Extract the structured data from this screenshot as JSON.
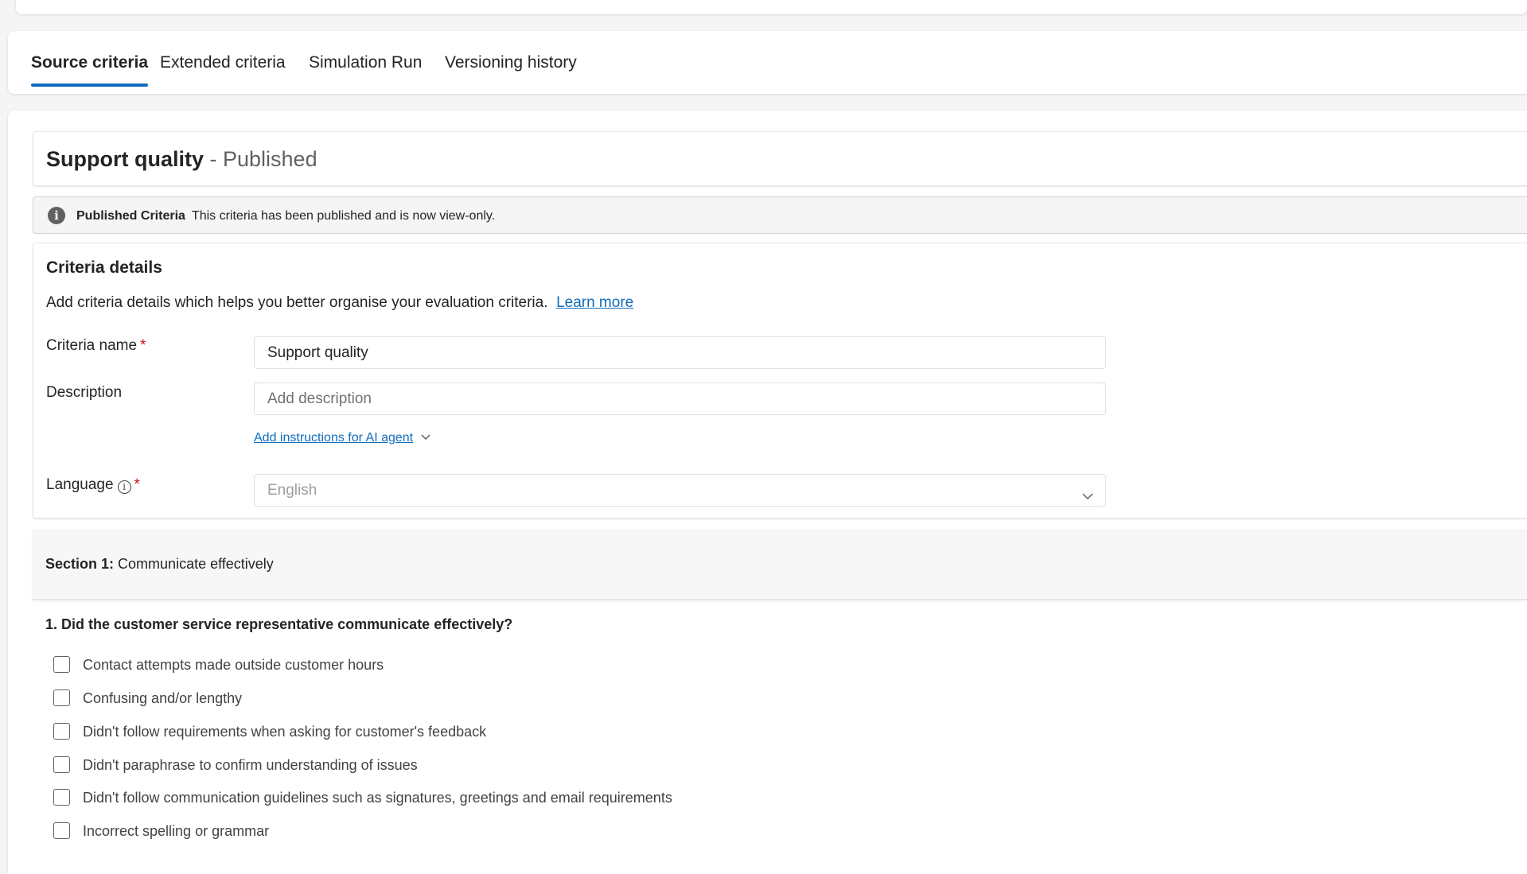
{
  "tabs": [
    {
      "label": "Source criteria",
      "active": true
    },
    {
      "label": "Extended criteria",
      "active": false
    },
    {
      "label": "Simulation Run",
      "active": false
    },
    {
      "label": "Versioning history",
      "active": false
    }
  ],
  "page": {
    "title": "Support quality",
    "separator": " - ",
    "status": "Published"
  },
  "banner": {
    "icon": "info-icon",
    "title": "Published Criteria",
    "message": "This criteria has been published and is now view-only."
  },
  "details": {
    "heading": "Criteria details",
    "description": "Add criteria details which helps you better organise your evaluation criteria.",
    "learn_more": "Learn more",
    "name_label": "Criteria name",
    "name_value": "Support quality",
    "description_label": "Description",
    "description_placeholder": "Add description",
    "ai_instructions_link": "Add instructions for AI agent",
    "language_label": "Language",
    "language_value": "English",
    "required_mark": "*"
  },
  "section": {
    "prefix": "Section 1:",
    "title": "Communicate effectively"
  },
  "question": {
    "text": "1. Did the customer service representative communicate effectively?",
    "options": [
      "Contact attempts made outside customer hours",
      "Confusing and/or lengthy",
      "Didn't follow requirements when asking for customer's feedback",
      "Didn't paraphrase to confirm understanding of issues",
      "Didn't follow communication guidelines such as signatures, greetings and email requirements",
      "Incorrect spelling or grammar"
    ]
  },
  "colors": {
    "accent": "#0f6cbd",
    "required": "#c50f1f"
  }
}
